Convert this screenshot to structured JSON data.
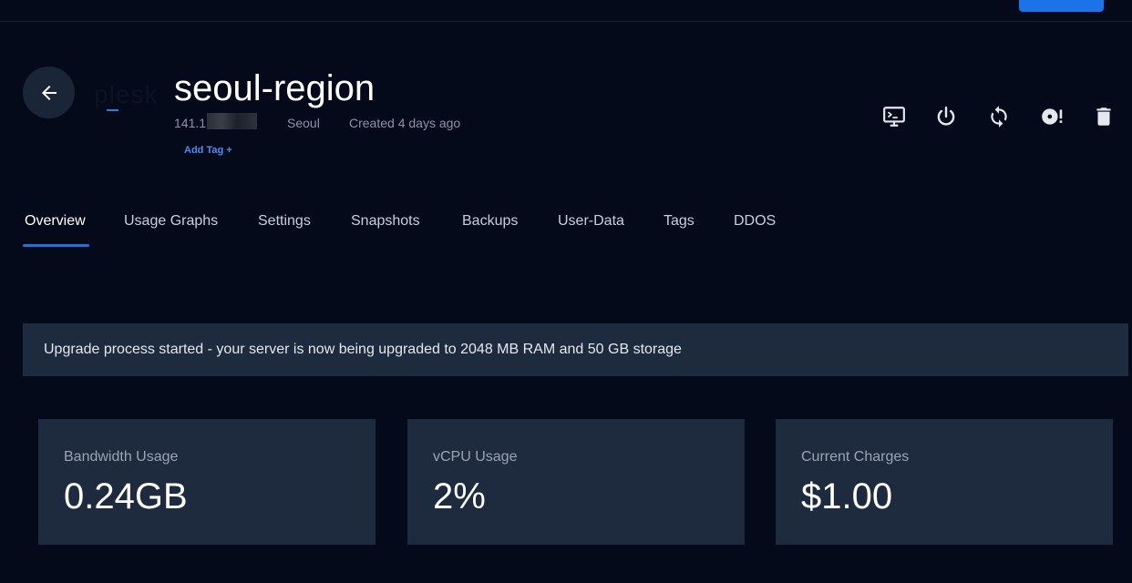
{
  "header": {
    "logo_text": "plesk",
    "server_name": "seoul-region",
    "ip_prefix": "141.1",
    "location": "Seoul",
    "created": "Created 4 days ago",
    "add_tag_label": "Add Tag +"
  },
  "actions": [
    {
      "name": "console",
      "icon": "monitor-terminal-icon"
    },
    {
      "name": "power",
      "icon": "power-icon"
    },
    {
      "name": "restart",
      "icon": "restart-icon"
    },
    {
      "name": "reinstall",
      "icon": "disc-alert-icon"
    },
    {
      "name": "destroy",
      "icon": "trash-icon"
    }
  ],
  "tabs": [
    {
      "label": "Overview",
      "active": true
    },
    {
      "label": "Usage Graphs",
      "active": false
    },
    {
      "label": "Settings",
      "active": false
    },
    {
      "label": "Snapshots",
      "active": false
    },
    {
      "label": "Backups",
      "active": false
    },
    {
      "label": "User-Data",
      "active": false
    },
    {
      "label": "Tags",
      "active": false
    },
    {
      "label": "DDOS",
      "active": false
    }
  ],
  "banner": {
    "message": "Upgrade process started - your server is now being upgraded to 2048 MB RAM and 50 GB storage"
  },
  "stats": [
    {
      "label": "Bandwidth Usage",
      "value": "0.24GB"
    },
    {
      "label": "vCPU Usage",
      "value": "2%"
    },
    {
      "label": "Current Charges",
      "value": "$1.00"
    }
  ],
  "colors": {
    "background": "#050a1a",
    "card": "#1e2a3d",
    "accent": "#1a73e8",
    "link": "#4a8ef0"
  }
}
